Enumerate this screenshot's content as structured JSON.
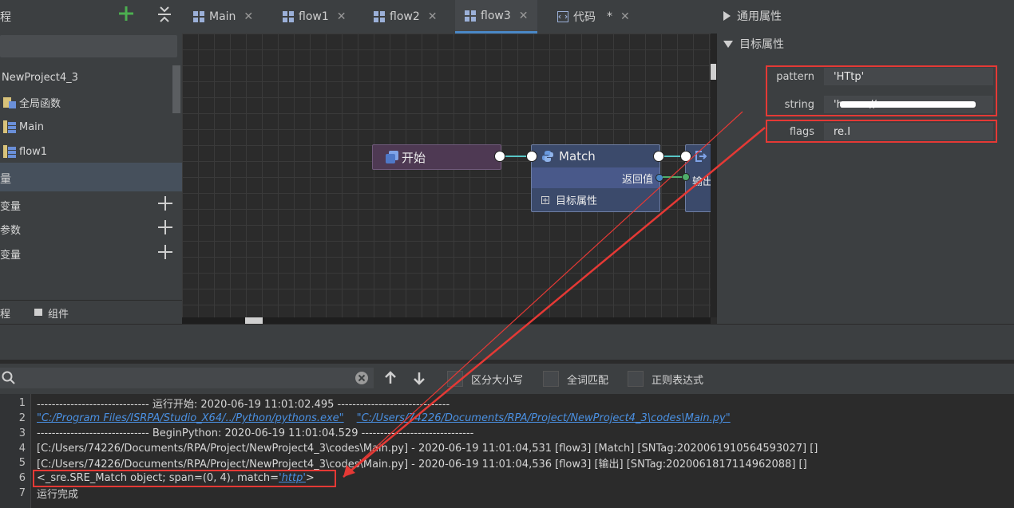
{
  "left_panel": {
    "header_label": "程",
    "tree": [
      {
        "label": "NewProject4_3",
        "icon": "project-icon"
      },
      {
        "label": "全局函数",
        "icon": "global-function-icon"
      },
      {
        "label": "Main",
        "icon": "flow-icon"
      },
      {
        "label": "flow1",
        "icon": "flow-icon"
      }
    ],
    "vars_header": "量",
    "var_groups": [
      "变量",
      "参数",
      "变量"
    ],
    "bottom_tabs": [
      "程",
      "组件"
    ]
  },
  "tabs": [
    {
      "label": "Main",
      "close": "✕"
    },
    {
      "label": "flow1",
      "close": "✕"
    },
    {
      "label": "flow2",
      "close": "✕"
    },
    {
      "label": "flow3",
      "close": "✕",
      "active": true
    },
    {
      "label": "代码",
      "modified": "*",
      "close": "✕"
    }
  ],
  "canvas": {
    "start_node": {
      "label": "开始"
    },
    "match_node": {
      "label": "Match",
      "output": "返回值",
      "attr": "目标属性"
    },
    "output_node": {
      "label": "输出"
    }
  },
  "properties": {
    "general_section": "通用属性",
    "target_section": "目标属性",
    "rows": [
      {
        "label": "pattern",
        "value": "'HTtp'"
      },
      {
        "label": "string",
        "value": "'h       ://                                            /'"
      },
      {
        "label": "flags",
        "value": "re.I"
      }
    ]
  },
  "find_bar": {
    "match_case": "区分大小写",
    "whole_word": "全词匹配",
    "regex": "正则表达式"
  },
  "console": {
    "lines": [
      {
        "n": "1",
        "text": "------------------------------ 运行开始: 2020-06-19 11:01:02.495 ------------------------------"
      },
      {
        "n": "2",
        "link1": "\"C:/Program Files/ISRPA/Studio_X64/../Python/pythons.exe\"",
        "link2": "\"C:/Users/74226/Documents/RPA/Project/NewProject4_3\\codes\\Main.py\""
      },
      {
        "n": "3",
        "text": "------------------------------ BeginPython: 2020-06-19 11:01:04.529 ------------------------------"
      },
      {
        "n": "4",
        "text": "[C:/Users/74226/Documents/RPA/Project/NewProject4_3\\codes\\Main.py] - 2020-06-19 11:01:04,531  [flow3] [Match]  [SNTag:2020061910564593027]  []"
      },
      {
        "n": "5",
        "text": "[C:/Users/74226/Documents/RPA/Project/NewProject4_3\\codes\\Main.py] - 2020-06-19 11:01:04,536  [flow3] [输出]  [SNTag:2020061817114962088]  []"
      },
      {
        "n": "6",
        "prefix": "<_sre.SRE_Match object; span=(0, 4), match=",
        "match": "'http'",
        "suffix": ">"
      },
      {
        "n": "7",
        "text": "运行完成"
      }
    ]
  },
  "colors": {
    "accent": "#4a88c7",
    "highlight_red": "#e53935",
    "wire": "#59c6c6"
  }
}
